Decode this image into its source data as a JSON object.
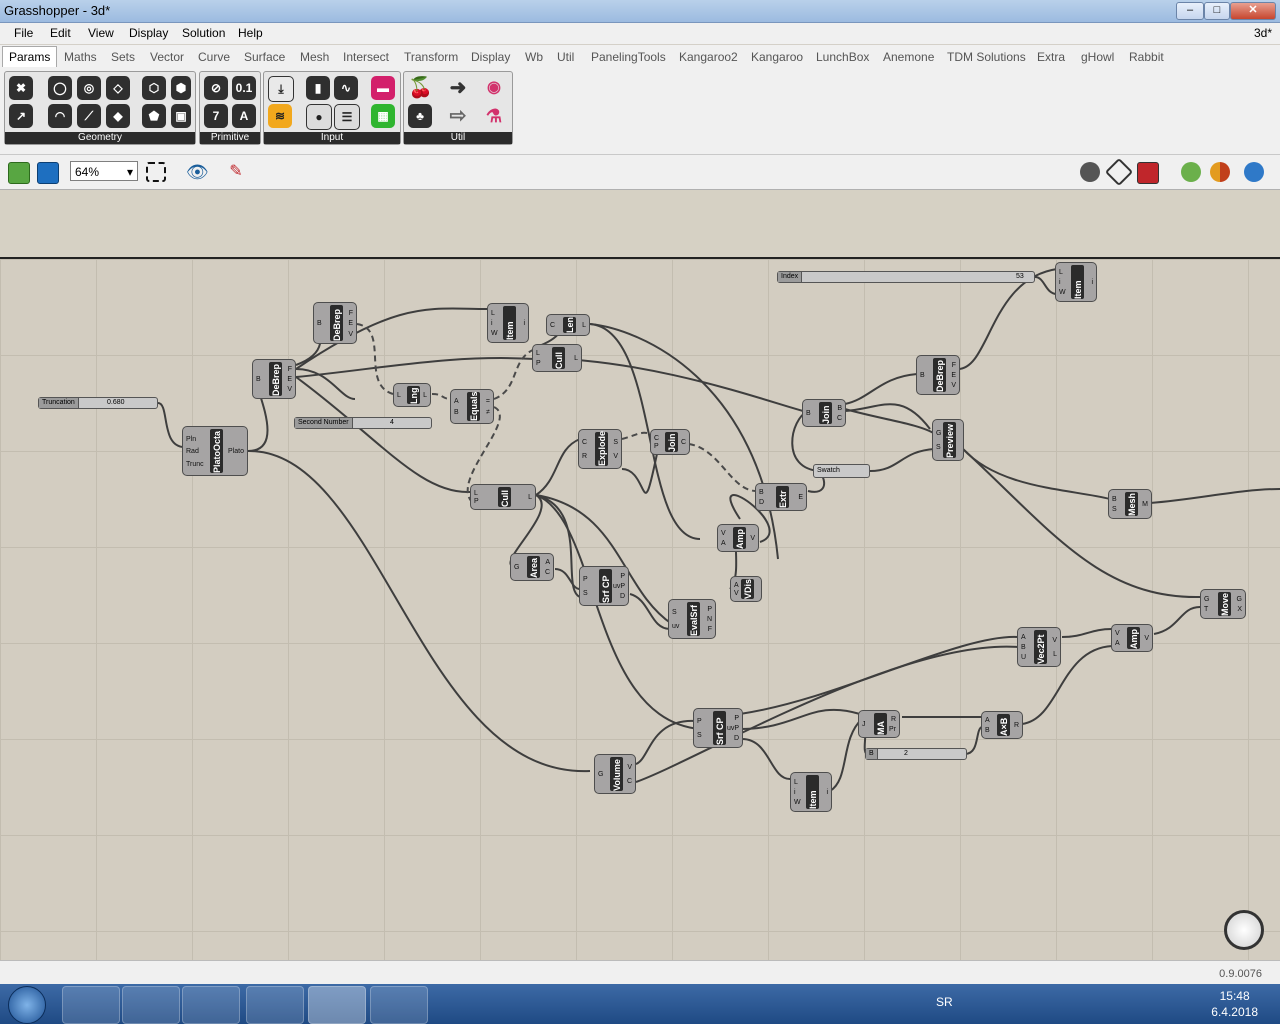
{
  "window": {
    "title": "Grasshopper - 3d*",
    "doc_label": "3d*"
  },
  "menu": [
    "File",
    "Edit",
    "View",
    "Display",
    "Solution",
    "Help"
  ],
  "tabs": [
    "Params",
    "Maths",
    "Sets",
    "Vector",
    "Curve",
    "Surface",
    "Mesh",
    "Intersect",
    "Transform",
    "Display",
    "Wb",
    "Util",
    "PanelingTools",
    "Kangaroo2",
    "Kangaroo",
    "LunchBox",
    "Anemone",
    "TDM Solutions",
    "Extra",
    "gHowl",
    "Rabbit"
  ],
  "ribbon_groups": [
    "Geometry",
    "Primitive",
    "Input",
    "Util"
  ],
  "toolbar": {
    "zoom": "64%"
  },
  "components": {
    "debrep1": {
      "name": "DeBrep",
      "in": [
        "B"
      ],
      "out": [
        "F",
        "E",
        "V"
      ]
    },
    "debrep2": {
      "name": "DeBrep",
      "in": [
        "B"
      ],
      "out": [
        "F",
        "E",
        "V"
      ]
    },
    "item1": {
      "name": "Item",
      "in": [
        "L",
        "i",
        "W"
      ],
      "out": [
        "i"
      ]
    },
    "len": {
      "name": "Len",
      "in": [
        "C"
      ],
      "out": [
        "L"
      ]
    },
    "cull1": {
      "name": "Cull",
      "in": [
        "L",
        "P"
      ],
      "out": [
        "L"
      ]
    },
    "lng": {
      "name": "Lng",
      "in": [
        "L"
      ],
      "out": [
        "L"
      ]
    },
    "equals": {
      "name": "Equals",
      "in": [
        "A",
        "B"
      ],
      "out": [
        "=",
        "≠"
      ]
    },
    "platoocta": {
      "name": "PlatoOcta",
      "in": [
        "Pln",
        "Rad",
        "Trunc"
      ],
      "out": [
        "Plato"
      ]
    },
    "explode": {
      "name": "Explode",
      "in": [
        "C",
        "R"
      ],
      "out": [
        "S",
        "V"
      ]
    },
    "join1": {
      "name": "Join",
      "in": [
        "C",
        "P"
      ],
      "out": [
        "C"
      ]
    },
    "cull2": {
      "name": "Cull",
      "in": [
        "L",
        "P"
      ],
      "out": [
        "L"
      ]
    },
    "join2": {
      "name": "Join",
      "in": [
        "B"
      ],
      "out": [
        "B",
        "C"
      ]
    },
    "debrep3": {
      "name": "DeBrep",
      "in": [
        "B"
      ],
      "out": [
        "F",
        "E",
        "V"
      ]
    },
    "item2": {
      "name": "Item",
      "in": [
        "L",
        "i",
        "W"
      ],
      "out": [
        "i"
      ]
    },
    "preview": {
      "name": "Preview",
      "in": [
        "G",
        "S"
      ],
      "out": []
    },
    "extr": {
      "name": "Extr",
      "in": [
        "B",
        "D"
      ],
      "out": [
        "E"
      ]
    },
    "amp1": {
      "name": "Amp",
      "in": [
        "V",
        "A"
      ],
      "out": [
        "V"
      ]
    },
    "area": {
      "name": "Area",
      "in": [
        "G"
      ],
      "out": [
        "A",
        "C"
      ]
    },
    "srfcp1": {
      "name": "Srf CP",
      "in": [
        "P",
        "S"
      ],
      "out": [
        "P",
        "uvP",
        "D"
      ]
    },
    "evalsrf": {
      "name": "EvalSrf",
      "in": [
        "S",
        "uv"
      ],
      "out": [
        "P",
        "N",
        "F"
      ]
    },
    "vdis": {
      "name": "VDis",
      "in": [
        "A",
        "V"
      ],
      "out": []
    },
    "mesh": {
      "name": "Mesh",
      "in": [
        "B",
        "S"
      ],
      "out": [
        "M"
      ]
    },
    "move": {
      "name": "Move",
      "in": [
        "G",
        "T"
      ],
      "out": [
        "G",
        "X"
      ]
    },
    "vec2pt": {
      "name": "Vec2Pt",
      "in": [
        "A",
        "B",
        "U"
      ],
      "out": [
        "V",
        "L"
      ]
    },
    "amp2": {
      "name": "Amp",
      "in": [
        "V",
        "A"
      ],
      "out": [
        "V"
      ]
    },
    "srfcp2": {
      "name": "Srf CP",
      "in": [
        "P",
        "S"
      ],
      "out": [
        "P",
        "uvP",
        "D"
      ]
    },
    "ma": {
      "name": "MA",
      "in": [
        "J"
      ],
      "out": [
        "R",
        "Pr"
      ]
    },
    "axb": {
      "name": "A×B",
      "in": [
        "A",
        "B"
      ],
      "out": [
        "R"
      ]
    },
    "volume": {
      "name": "Volume",
      "in": [
        "G"
      ],
      "out": [
        "V",
        "C"
      ]
    },
    "item3": {
      "name": "Item",
      "in": [
        "L",
        "i",
        "W"
      ],
      "out": [
        "i"
      ]
    }
  },
  "sliders": {
    "truncation": {
      "label": "Truncation",
      "value": "0.680"
    },
    "second_number": {
      "label": "Second Number",
      "value": "4"
    },
    "index": {
      "label": "Index",
      "value": "53"
    },
    "b": {
      "label": "B",
      "value": "2"
    }
  },
  "swatch": {
    "label": "Swatch"
  },
  "status": {
    "version": "0.9.0076"
  },
  "taskbar": {
    "lang": "SR",
    "time": "15:48",
    "date": "6.4.2018"
  }
}
